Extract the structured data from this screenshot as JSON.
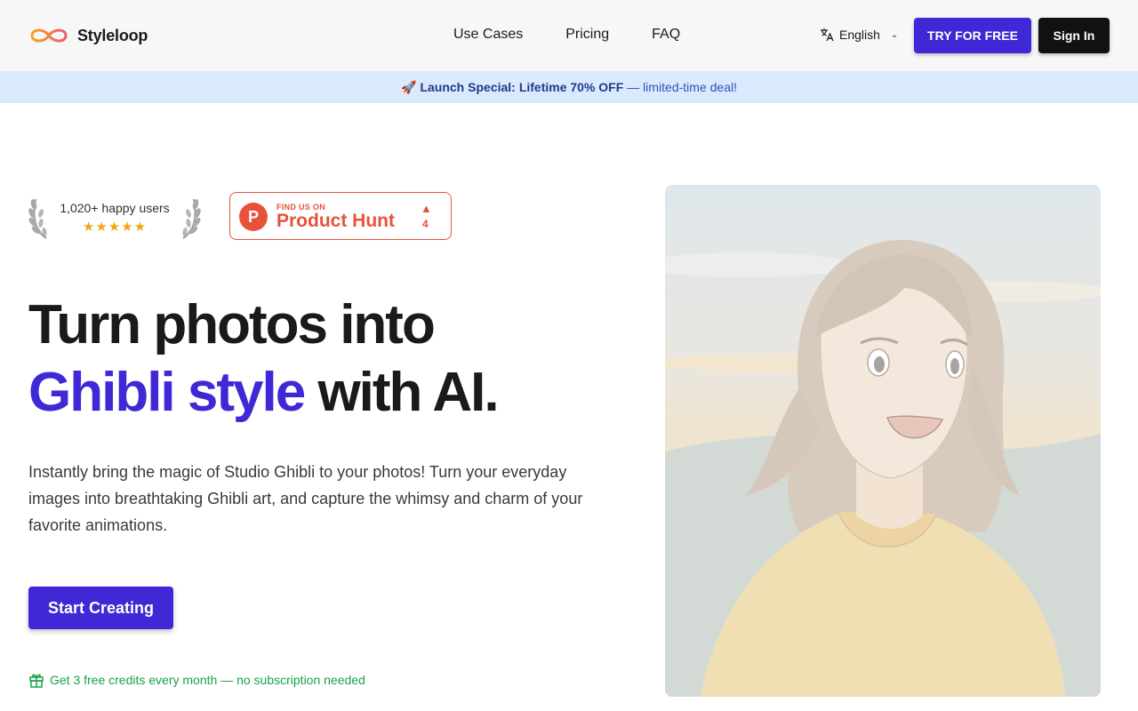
{
  "header": {
    "brand": "Styleloop",
    "nav": [
      "Use Cases",
      "Pricing",
      "FAQ"
    ],
    "language": "English",
    "try_label": "TRY FOR FREE",
    "signin_label": "Sign In"
  },
  "banner": {
    "emoji": "🚀",
    "prefix": "Launch Special:",
    "deal": "Lifetime 70% OFF",
    "suffix": "— limited-time deal!"
  },
  "badges": {
    "users": "1,020+ happy users",
    "stars": "★★★★★",
    "rating": 5,
    "ph_small": "FIND US ON",
    "ph_big": "Product Hunt",
    "ph_count": "4"
  },
  "hero": {
    "title_line1": "Turn photos into",
    "title_accent": "Ghibli style",
    "title_rest": "with AI.",
    "description": "Instantly bring the magic of Studio Ghibli to your photos! Turn your everyday images into breathtaking Ghibli art, and capture the whimsy and charm of your favorite animations.",
    "cta": "Start Creating",
    "free_note": "Get 3 free credits every month — no subscription needed"
  },
  "colors": {
    "accent": "#3f29d6",
    "product_hunt": "#e8523a",
    "banner_bg": "#dbe9fe",
    "success": "#16a34a"
  }
}
